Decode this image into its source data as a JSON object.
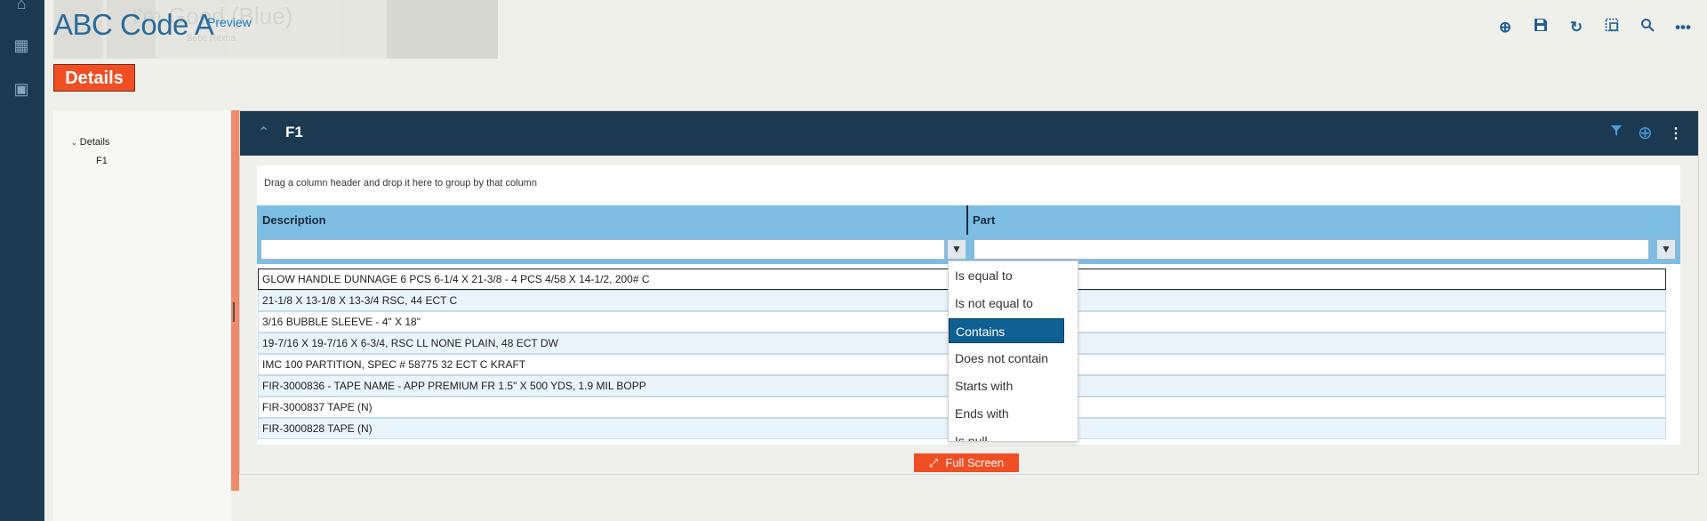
{
  "header": {
    "title": "ABC Code A",
    "preview_label": "Preview",
    "ghost_title": "I'm Good (Blue)",
    "ghost_subtitle": "Bebe Rexha"
  },
  "toolbar": {
    "icons": [
      "add-circle-icon",
      "save-icon",
      "refresh-icon",
      "layout-icon",
      "search-icon",
      "more-icon"
    ]
  },
  "tabs": {
    "details_label": "Details"
  },
  "tree": {
    "root_label": "Details",
    "child_label": "F1"
  },
  "panel": {
    "title": "F1",
    "group_hint": "Drag a column header and drop it here to group by that column",
    "columns": {
      "description": "Description",
      "part": "Part"
    },
    "rows": [
      "GLOW HANDLE DUNNAGE 6 PCS 6-1/4 X 21-3/8 - 4 PCS 4/58 X 14-1/2, 200# C",
      "21-1/8 X 13-1/8 X 13-3/4 RSC, 44 ECT C",
      "3/16 BUBBLE SLEEVE - 4\" X 18\"",
      "19-7/16 X 19-7/16 X 6-3/4, RSC LL NONE PLAIN, 48 ECT DW",
      "IMC 100 PARTITION, SPEC # 58775 32 ECT C KRAFT",
      "FIR-3000836 - TAPE NAME - APP PREMIUM FR 1.5\" X 500 YDS, 1.9 MIL BOPP",
      "FIR-3000837 TAPE (N)",
      "FIR-3000828 TAPE (N)"
    ]
  },
  "filter_menu": {
    "options": [
      "Is equal to",
      "Is not equal to",
      "Contains",
      "Does not contain",
      "Starts with",
      "Ends with",
      "Is null"
    ],
    "selected": "Contains"
  },
  "fullscreen_label": "Full Screen",
  "colors": {
    "nav": "#1b3a52",
    "accent": "#f04e23",
    "header_blue": "#7dbde3",
    "selected": "#0e5f92"
  }
}
